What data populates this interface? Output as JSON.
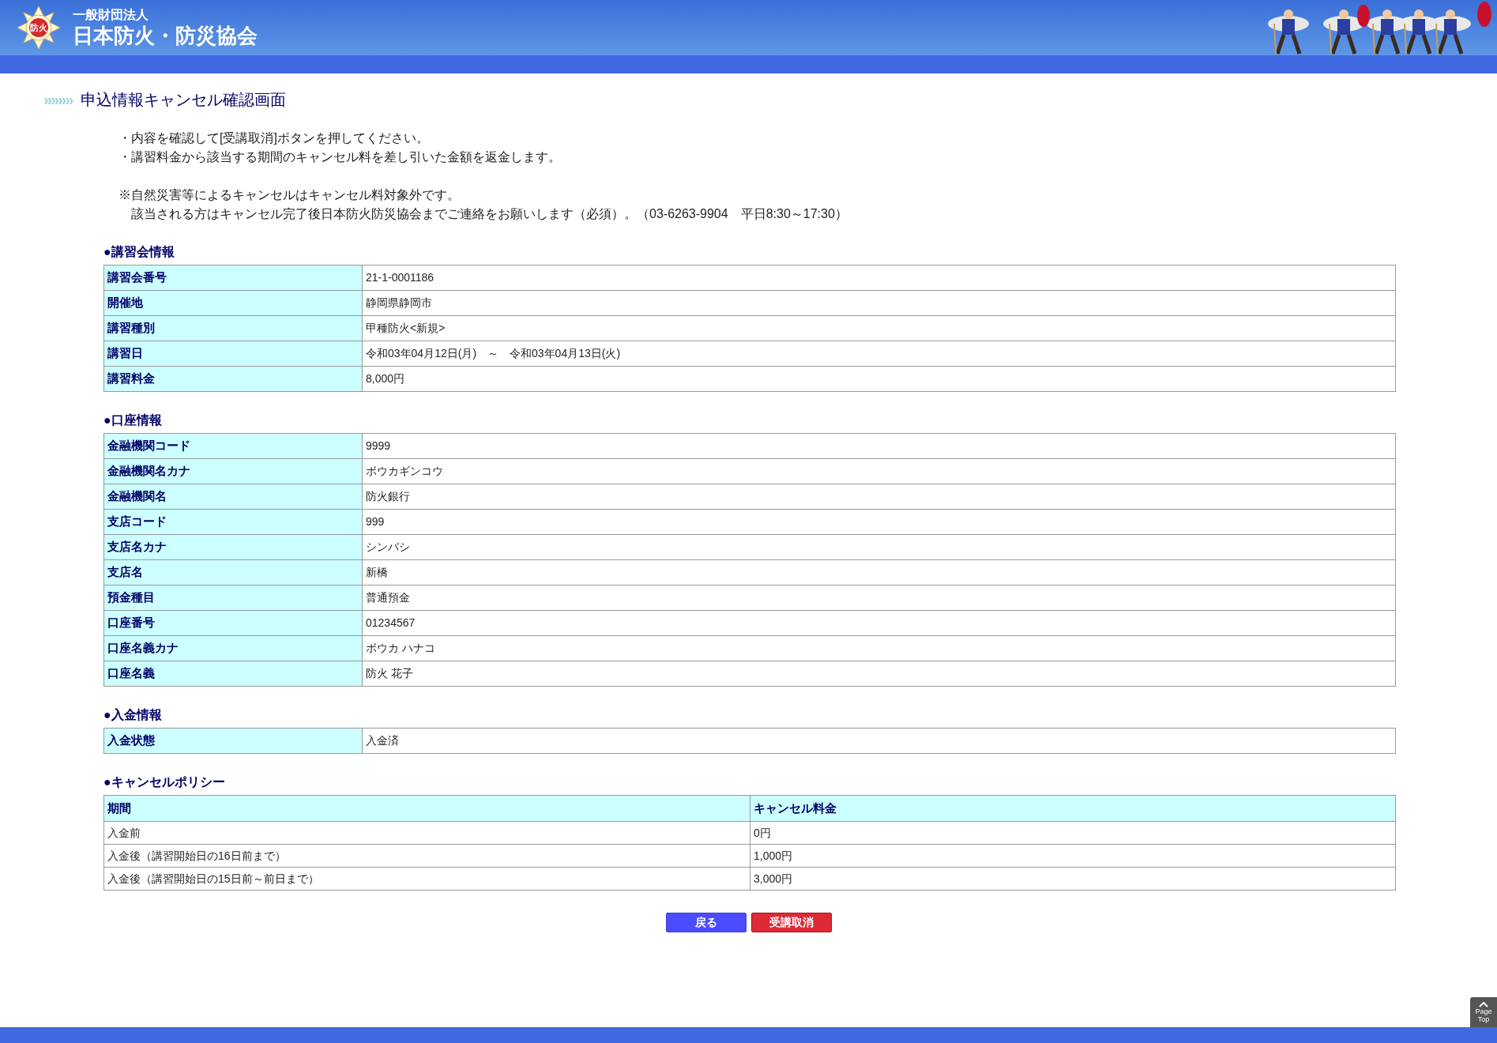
{
  "header": {
    "logo_text": "防火",
    "org_type": "一般財団法人",
    "org_name": "日本防火・防災協会"
  },
  "page_title": {
    "arrows": "»»»»",
    "text": "申込情報キャンセル確認画面"
  },
  "notes": [
    "・内容を確認して[受講取消]ボタンを押してください。",
    "・講習料金から該当する期間のキャンセル料を差し引いた金額を返金します。"
  ],
  "remarks": [
    "※自然災害等によるキャンセルはキャンセル料対象外です。",
    "　該当される方はキャンセル完了後日本防火防災協会までご連絡をお願いします（必須）。（03-6263-9904　平日8:30～17:30）"
  ],
  "sections": [
    {
      "heading": "●講習会情報",
      "rows": [
        {
          "label": "講習会番号",
          "value": "21-1-0001186"
        },
        {
          "label": "開催地",
          "value": "静岡県静岡市"
        },
        {
          "label": "講習種別",
          "value": "甲種防火<新規>"
        },
        {
          "label": "講習日",
          "value": "令和03年04月12日(月)　～　令和03年04月13日(火)"
        },
        {
          "label": "講習料金",
          "value": "8,000円"
        }
      ]
    },
    {
      "heading": "●口座情報",
      "rows": [
        {
          "label": "金融機関コード",
          "value": "9999"
        },
        {
          "label": "金融機関名カナ",
          "value": "ボウカギンコウ"
        },
        {
          "label": "金融機関名",
          "value": "防火銀行"
        },
        {
          "label": "支店コード",
          "value": "999"
        },
        {
          "label": "支店名カナ",
          "value": "シンバシ"
        },
        {
          "label": "支店名",
          "value": "新橋"
        },
        {
          "label": "預金種目",
          "value": "普通預金"
        },
        {
          "label": "口座番号",
          "value": "01234567"
        },
        {
          "label": "口座名義カナ",
          "value": "ボウカ ハナコ"
        },
        {
          "label": "口座名義",
          "value": "防火 花子"
        }
      ]
    },
    {
      "heading": "●入金情報",
      "rows": [
        {
          "label": "入金状態",
          "value": "入金済"
        }
      ]
    }
  ],
  "policy": {
    "heading": "●キャンセルポリシー",
    "columns": [
      "期間",
      "キャンセル料金"
    ],
    "rows": [
      [
        "入金前",
        "0円"
      ],
      [
        "入金後（講習開始日の16日前まで）",
        "1,000円"
      ],
      [
        "入金後（講習開始日の15日前～前日まで）",
        "3,000円"
      ]
    ]
  },
  "buttons": [
    {
      "label": "戻る",
      "kind": "back"
    },
    {
      "label": "受講取消",
      "kind": "cancel"
    }
  ],
  "page_top": {
    "label_1": "Page",
    "label_2": "Top"
  }
}
